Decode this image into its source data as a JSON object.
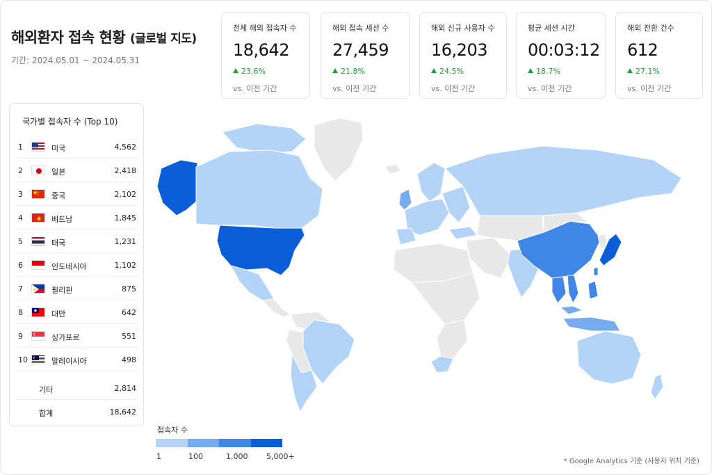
{
  "header": {
    "title": "해외환자 접속 현황",
    "title_suffix": "(글로벌 지도)",
    "period": "기간: 2024.05.01 ~ 2024.05.31"
  },
  "kpis": [
    {
      "label": "전체 해외 접속자 수",
      "value": "18,642",
      "change": "23.6%",
      "compare": "vs. 이전 기간"
    },
    {
      "label": "해외 접속 세션 수",
      "value": "27,459",
      "change": "21.8%",
      "compare": "vs. 이전 기간"
    },
    {
      "label": "해외 신규 사용자 수",
      "value": "16,203",
      "change": "24.5%",
      "compare": "vs. 이전 기간"
    },
    {
      "label": "평균 세션 시간",
      "value": "00:03:12",
      "change": "18.7%",
      "compare": "vs. 이전 기간"
    },
    {
      "label": "해외 전환 건수",
      "value": "612",
      "change": "27.1%",
      "compare": "vs. 이전 기간"
    }
  ],
  "ranking": {
    "title": "국가별 접속자 수 (Top 10)",
    "rows": [
      {
        "rank": "1",
        "country": "미국",
        "count": "4,562",
        "flag": "us-flag-icon"
      },
      {
        "rank": "2",
        "country": "일본",
        "count": "2,418",
        "flag": "jp-flag-icon"
      },
      {
        "rank": "3",
        "country": "중국",
        "count": "2,102",
        "flag": "cn-flag-icon"
      },
      {
        "rank": "4",
        "country": "베트남",
        "count": "1,845",
        "flag": "vn-flag-icon"
      },
      {
        "rank": "5",
        "country": "태국",
        "count": "1,231",
        "flag": "th-flag-icon"
      },
      {
        "rank": "6",
        "country": "인도네시아",
        "count": "1,102",
        "flag": "id-flag-icon"
      },
      {
        "rank": "7",
        "country": "필리핀",
        "count": "875",
        "flag": "ph-flag-icon"
      },
      {
        "rank": "8",
        "country": "대만",
        "count": "642",
        "flag": "tw-flag-icon"
      },
      {
        "rank": "9",
        "country": "싱가포르",
        "count": "551",
        "flag": "sg-flag-icon"
      },
      {
        "rank": "10",
        "country": "말레이시아",
        "count": "498",
        "flag": "my-flag-icon"
      }
    ],
    "other": {
      "label": "기타",
      "count": "2,814"
    },
    "total": {
      "label": "합계",
      "count": "18,642"
    }
  },
  "legend": {
    "title": "접속자 수",
    "labels": [
      "1",
      "100",
      "1,000",
      "5,000+"
    ],
    "colors": [
      "#b3d3f7",
      "#76acef",
      "#3f86e6",
      "#0b5ed7"
    ]
  },
  "colors": {
    "no_data": "#e8e8e8",
    "positive": "#1f9d3a"
  },
  "footnote": "* Google Analytics 기준 (사용자 위치 기준)"
}
